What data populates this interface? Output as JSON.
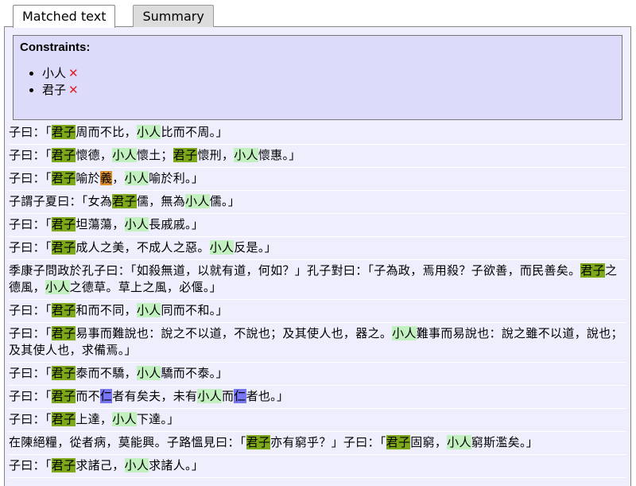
{
  "tabs": [
    {
      "label": "Matched text",
      "active": true
    },
    {
      "label": "Summary",
      "active": false
    }
  ],
  "constraints": {
    "title": "Constraints:",
    "items": [
      {
        "term": "小人",
        "status_icon": "cross-icon"
      },
      {
        "term": "君子",
        "status_icon": "cross-icon"
      }
    ],
    "cross_mark": "✕"
  },
  "highlight_colors": {
    "君子": "#7ca81a",
    "小人": "#c2f1bf",
    "義": "#e0912e",
    "仁": "#7876f3"
  },
  "rows": [
    [
      [
        "子曰：「",
        ""
      ],
      [
        "君子",
        "j"
      ],
      [
        "周而不比，",
        ""
      ],
      [
        "小人",
        "x"
      ],
      [
        "比而不周。」",
        ""
      ]
    ],
    [
      [
        "子曰：「",
        ""
      ],
      [
        "君子",
        "j"
      ],
      [
        "懷德，",
        ""
      ],
      [
        "小人",
        "x"
      ],
      [
        "懷土；",
        ""
      ],
      [
        "君子",
        "j"
      ],
      [
        "懷刑，",
        ""
      ],
      [
        "小人",
        "x"
      ],
      [
        "懷惠。」",
        ""
      ]
    ],
    [
      [
        "子曰：「",
        ""
      ],
      [
        "君子",
        "j"
      ],
      [
        "喻於",
        ""
      ],
      [
        "義",
        "y"
      ],
      [
        "，",
        ""
      ],
      [
        "小人",
        "x"
      ],
      [
        "喻於利。」",
        ""
      ]
    ],
    [
      [
        "子謂子夏曰：「女為",
        ""
      ],
      [
        "君子",
        "j"
      ],
      [
        "儒，無為",
        ""
      ],
      [
        "小人",
        "x"
      ],
      [
        "儒。」",
        ""
      ]
    ],
    [
      [
        "子曰：「",
        ""
      ],
      [
        "君子",
        "j"
      ],
      [
        "坦蕩蕩，",
        ""
      ],
      [
        "小人",
        "x"
      ],
      [
        "長戚戚。」",
        ""
      ]
    ],
    [
      [
        "子曰：「",
        ""
      ],
      [
        "君子",
        "j"
      ],
      [
        "成人之美，不成人之惡。",
        ""
      ],
      [
        "小人",
        "x"
      ],
      [
        "反是。」",
        ""
      ]
    ],
    [
      [
        "季康子問政於孔子曰：「如殺無道，以就有道，何如？」孔子對曰：「子為政，焉用殺？子欲善，而民善矣。",
        ""
      ],
      [
        "君子",
        "j"
      ],
      [
        "之德風，",
        ""
      ],
      [
        "小人",
        "x"
      ],
      [
        "之德草。草上之風，必偃。」",
        ""
      ]
    ],
    [
      [
        "子曰：「",
        ""
      ],
      [
        "君子",
        "j"
      ],
      [
        "和而不同，",
        ""
      ],
      [
        "小人",
        "x"
      ],
      [
        "同而不和。」",
        ""
      ]
    ],
    [
      [
        "子曰：「",
        ""
      ],
      [
        "君子",
        "j"
      ],
      [
        "易事而難說也：說之不以道，不說也；及其使人也，器之。",
        ""
      ],
      [
        "小人",
        "x"
      ],
      [
        "難事而易說也：說之雖不以道，說也；及其使人也，求備焉。」",
        ""
      ]
    ],
    [
      [
        "子曰：「",
        ""
      ],
      [
        "君子",
        "j"
      ],
      [
        "泰而不驕，",
        ""
      ],
      [
        "小人",
        "x"
      ],
      [
        "驕而不泰。」",
        ""
      ]
    ],
    [
      [
        "子曰：「",
        ""
      ],
      [
        "君子",
        "j"
      ],
      [
        "而不",
        ""
      ],
      [
        "仁",
        "r"
      ],
      [
        "者有矣夫，未有",
        ""
      ],
      [
        "小人",
        "x"
      ],
      [
        "而",
        ""
      ],
      [
        "仁",
        "r"
      ],
      [
        "者也。」",
        ""
      ]
    ],
    [
      [
        "子曰：「",
        ""
      ],
      [
        "君子",
        "j"
      ],
      [
        "上達，",
        ""
      ],
      [
        "小人",
        "x"
      ],
      [
        "下達。」",
        ""
      ]
    ],
    [
      [
        "在陳絕糧，從者病，莫能興。子路慍見曰：「",
        ""
      ],
      [
        "君子",
        "j"
      ],
      [
        "亦有窮乎？」子曰：「",
        ""
      ],
      [
        "君子",
        "j"
      ],
      [
        "固窮，",
        ""
      ],
      [
        "小人",
        "x"
      ],
      [
        "窮斯濫矣。」",
        ""
      ]
    ],
    [
      [
        "子曰：「",
        ""
      ],
      [
        "君子",
        "j"
      ],
      [
        "求諸己，",
        ""
      ],
      [
        "小人",
        "x"
      ],
      [
        "求諸人。」",
        ""
      ]
    ]
  ]
}
